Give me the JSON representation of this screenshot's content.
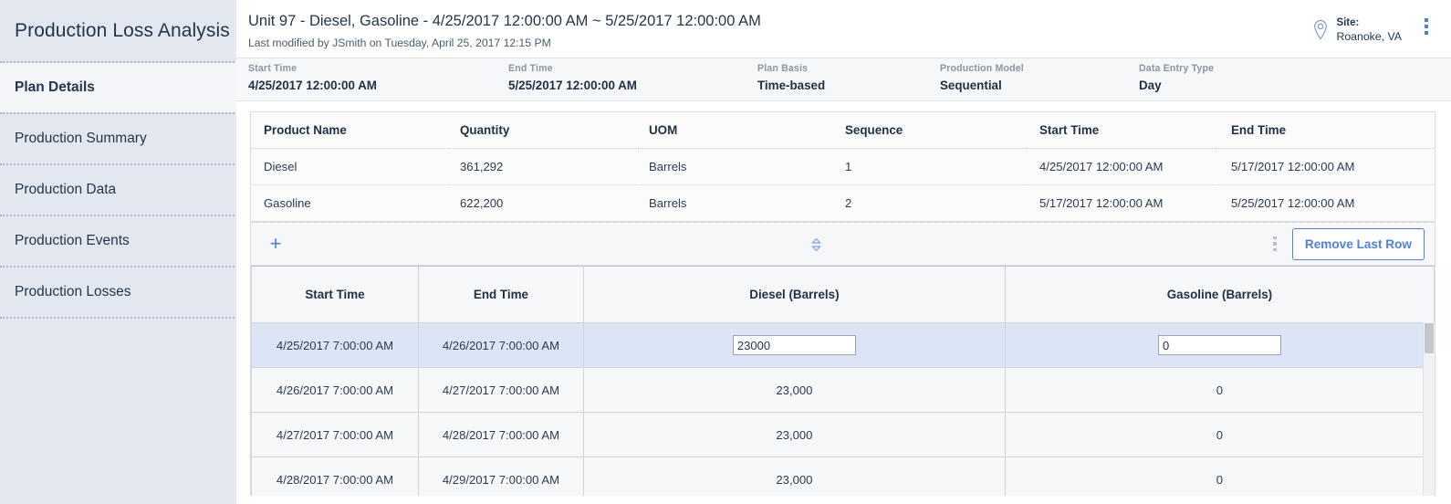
{
  "sidebar": {
    "title": "Production Loss Analysis",
    "collapse_icon": "chevron-left-icon",
    "items": [
      {
        "label": "Plan Details",
        "active": true
      },
      {
        "label": "Production Summary",
        "active": false
      },
      {
        "label": "Production Data",
        "active": false
      },
      {
        "label": "Production Events",
        "active": false
      },
      {
        "label": "Production Losses",
        "active": false
      }
    ]
  },
  "header": {
    "title": "Unit 97 - Diesel, Gasoline - 4/25/2017 12:00:00 AM ~ 5/25/2017 12:00:00 AM",
    "subtitle": "Last modified by JSmith on Tuesday, April 25, 2017 12:15 PM",
    "site_label": "Site:",
    "site_value": "Roanoke, VA",
    "site_icon": "map-pin-icon",
    "menu_icon": "kebab-menu-icon"
  },
  "summary": [
    {
      "label": "Start Time",
      "value": "4/25/2017 12:00:00 AM"
    },
    {
      "label": "End Time",
      "value": "5/25/2017 12:00:00 AM"
    },
    {
      "label": "Plan Basis",
      "value": "Time-based"
    },
    {
      "label": "Production Model",
      "value": "Sequential"
    },
    {
      "label": "Data Entry Type",
      "value": "Day"
    }
  ],
  "products_table": {
    "columns": [
      "Product Name",
      "Quantity",
      "UOM",
      "Sequence",
      "Start Time",
      "End Time"
    ],
    "rows": [
      [
        "Diesel",
        "361,292",
        "Barrels",
        "1",
        "4/25/2017 12:00:00 AM",
        "5/17/2017 12:00:00 AM"
      ],
      [
        "Gasoline",
        "622,200",
        "Barrels",
        "2",
        "5/17/2017 12:00:00 AM",
        "5/25/2017 12:00:00 AM"
      ]
    ]
  },
  "grid_toolbar": {
    "add_icon": "plus-icon",
    "sort_icon": "sort-updown-icon",
    "overflow_icon": "kebab-menu-icon",
    "remove_last_row_label": "Remove Last Row"
  },
  "data_grid": {
    "columns": [
      "Start Time",
      "End Time",
      "Diesel (Barrels)",
      "Gasoline (Barrels)"
    ],
    "rows": [
      {
        "selected": true,
        "editing": true,
        "start_time": "4/25/2017 7:00:00 AM",
        "end_time": "4/26/2017 7:00:00 AM",
        "diesel": "23000",
        "gasoline": "0"
      },
      {
        "selected": false,
        "editing": false,
        "start_time": "4/26/2017 7:00:00 AM",
        "end_time": "4/27/2017 7:00:00 AM",
        "diesel": "23,000",
        "gasoline": "0"
      },
      {
        "selected": false,
        "editing": false,
        "start_time": "4/27/2017 7:00:00 AM",
        "end_time": "4/28/2017 7:00:00 AM",
        "diesel": "23,000",
        "gasoline": "0"
      },
      {
        "selected": false,
        "editing": false,
        "start_time": "4/28/2017 7:00:00 AM",
        "end_time": "4/29/2017 7:00:00 AM",
        "diesel": "23,000",
        "gasoline": "0"
      }
    ]
  },
  "colors": {
    "accent": "#4f7fe0",
    "sidebar_bg": "#e3e8f0",
    "selected_row": "#dbe5f5",
    "header_bg": "#f6f7f9"
  }
}
